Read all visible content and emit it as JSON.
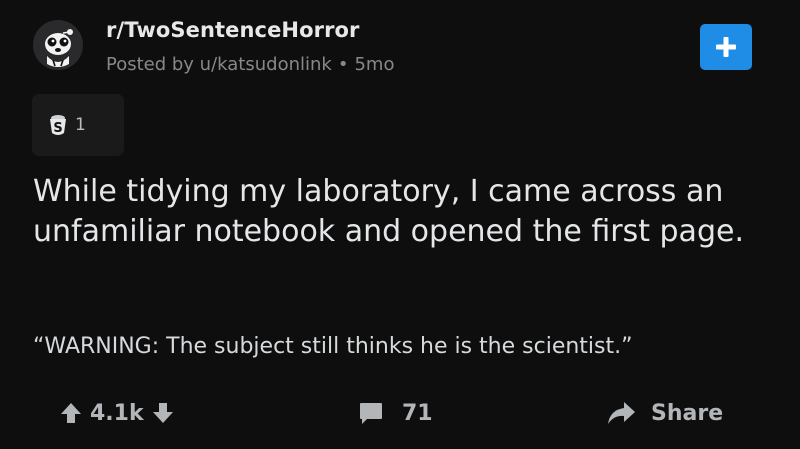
{
  "post": {
    "subreddit": "r/TwoSentenceHorror",
    "posted_by": "Posted by u/katsudonlink",
    "age": "5mo",
    "award_count": "1",
    "title": "While tidying my laboratory, I came across an unfamiliar notebook and opened the first page.",
    "body": "“WARNING: The subject still thinks he is the scientist.”"
  },
  "actions": {
    "vote_count": "4.1k",
    "comment_count": "71",
    "share_label": "Share"
  },
  "icons": {
    "avatar": "subreddit-avatar-icon",
    "join": "plus-icon",
    "award": "silver-award-icon",
    "upvote": "upvote-arrow-icon",
    "downvote": "downvote-arrow-icon",
    "comment": "comment-bubble-icon",
    "share": "share-arrow-icon"
  },
  "colors": {
    "background": "#0e0e0f",
    "accent": "#1f8ce6",
    "meta_text": "#86898c"
  }
}
